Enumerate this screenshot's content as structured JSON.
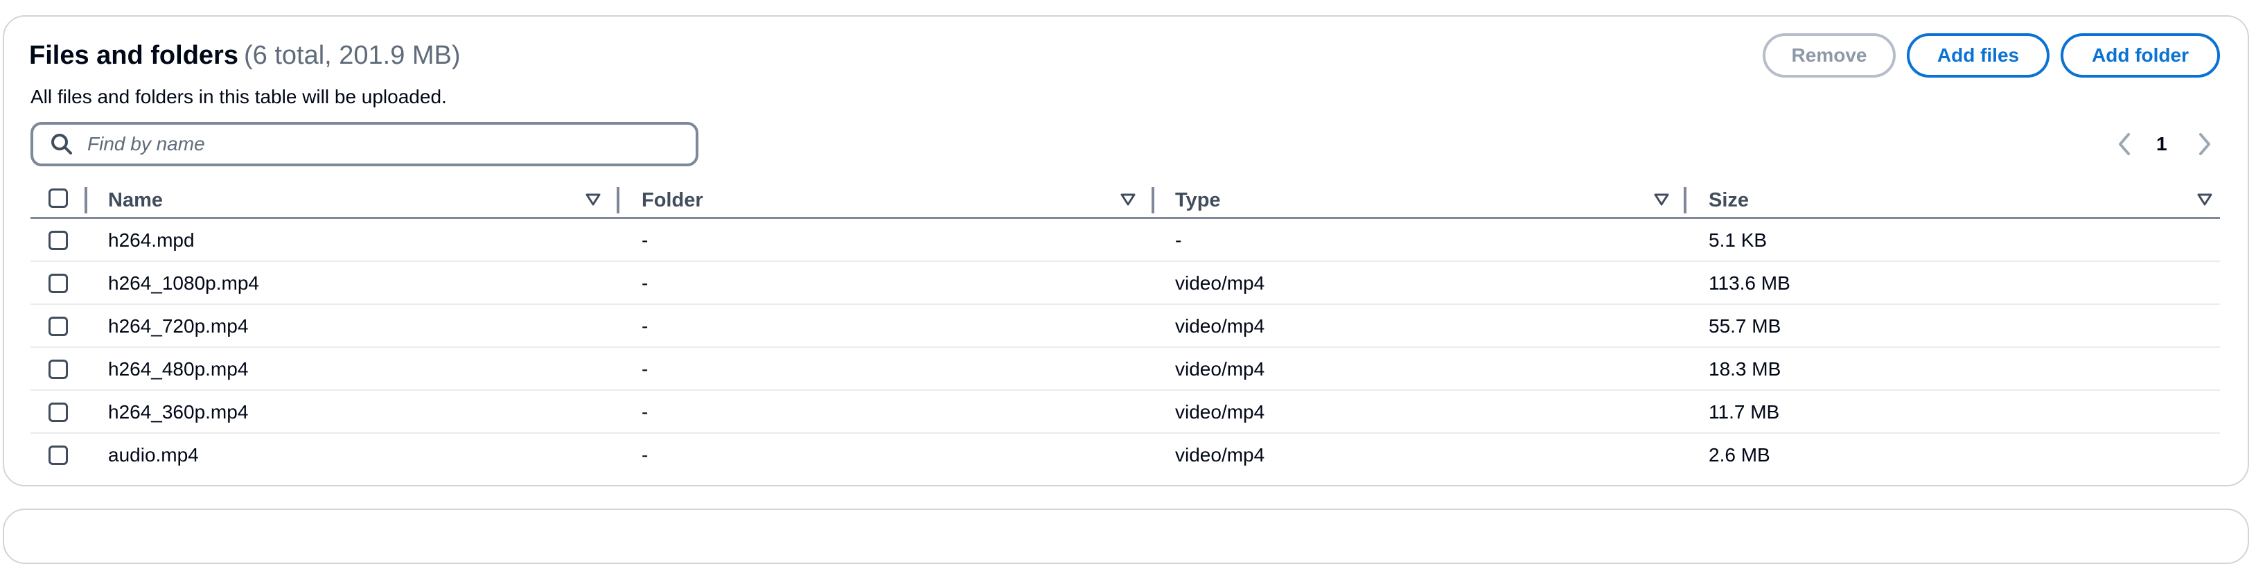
{
  "header": {
    "title": "Files and folders",
    "count": "(6 total, 201.9 MB)",
    "description": "All files and folders in this table will be uploaded."
  },
  "actions": {
    "remove": "Remove",
    "add_files": "Add files",
    "add_folder": "Add folder"
  },
  "search": {
    "placeholder": "Find by name",
    "value": ""
  },
  "pagination": {
    "current_page": "1"
  },
  "table": {
    "columns": [
      "Name",
      "Folder",
      "Type",
      "Size"
    ],
    "rows": [
      {
        "name": "h264.mpd",
        "folder": "-",
        "type": "-",
        "size": "5.1 KB"
      },
      {
        "name": "h264_1080p.mp4",
        "folder": "-",
        "type": "video/mp4",
        "size": "113.6 MB"
      },
      {
        "name": "h264_720p.mp4",
        "folder": "-",
        "type": "video/mp4",
        "size": "55.7 MB"
      },
      {
        "name": "h264_480p.mp4",
        "folder": "-",
        "type": "video/mp4",
        "size": "18.3 MB"
      },
      {
        "name": "h264_360p.mp4",
        "folder": "-",
        "type": "video/mp4",
        "size": "11.7 MB"
      },
      {
        "name": "audio.mp4",
        "folder": "-",
        "type": "video/mp4",
        "size": "2.6 MB"
      }
    ]
  },
  "icons": {
    "search": "search-icon",
    "sort": "sort-caret-down-icon",
    "prev": "chevron-left-icon",
    "next": "chevron-right-icon"
  },
  "colors": {
    "primary": "#0972d3",
    "disabled": "#8d99a8",
    "text": "#000716",
    "secondary_text": "#5f6b7a",
    "border": "#7d8998"
  }
}
